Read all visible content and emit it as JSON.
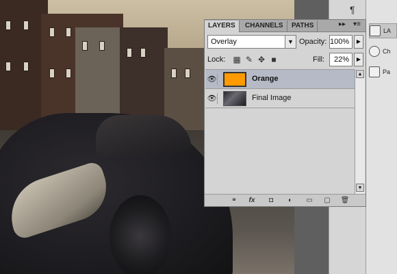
{
  "layers_panel": {
    "tabs": [
      {
        "label": "LAYERS",
        "active": true
      },
      {
        "label": "CHANNELS",
        "active": false
      },
      {
        "label": "PATHS",
        "active": false
      }
    ],
    "blend_mode": "Overlay",
    "opacity_label": "Opacity:",
    "opacity_value": "100%",
    "lock_label": "Lock:",
    "fill_label": "Fill:",
    "fill_value": "22%",
    "layers": [
      {
        "name": "Orange",
        "selected": true,
        "thumb": "orange-fill",
        "visible": true
      },
      {
        "name": "Final Image",
        "selected": false,
        "thumb": "photo",
        "visible": true
      }
    ],
    "bottom_icons": [
      "link-icon",
      "fx-icon",
      "mask-icon",
      "adjustment-icon",
      "folder-icon",
      "new-layer-icon",
      "trash-icon"
    ]
  },
  "mini_panel": {
    "paragraph_icon": "¶"
  },
  "right_dock": {
    "items": [
      {
        "label": "LA",
        "icon": "layers-icon",
        "active": true
      },
      {
        "label": "Ch",
        "icon": "channels-icon",
        "active": false
      },
      {
        "label": "Pa",
        "icon": "paths-icon",
        "active": false
      }
    ]
  },
  "colors": {
    "orange_fill": "#ff9a00",
    "selected_row": "#b5bac6",
    "panel_bg": "#d4d4d4"
  }
}
